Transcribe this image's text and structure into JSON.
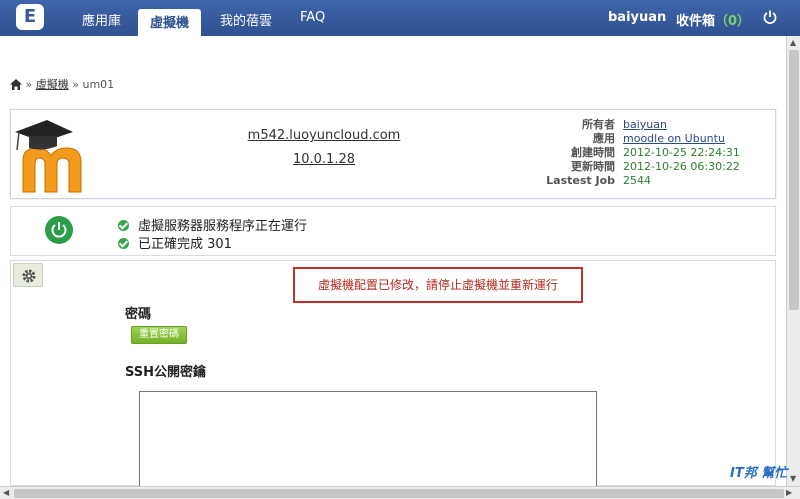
{
  "nav": {
    "logo_glyph": "E",
    "items": [
      {
        "label": "應用庫"
      },
      {
        "label": "虛擬機"
      },
      {
        "label": "我的蓓雲"
      },
      {
        "label": "FAQ"
      }
    ],
    "user": "baiyuan",
    "inbox_label": "收件箱",
    "inbox_count": "（0）"
  },
  "breadcrumb": {
    "sep": "»",
    "link": "虛擬機",
    "current": "um01"
  },
  "vm": {
    "host": "m542.luoyuncloud.com",
    "ip": "10.0.1.28",
    "labels": [
      "所有者",
      "應用",
      "創建時間",
      "更新時間",
      "Lastest Job"
    ],
    "owner": "baiyuan",
    "app": "moodle on Ubuntu",
    "created": "2012-10-25 22:24:31",
    "updated": "2012-10-26 06:30:22",
    "job": "2544"
  },
  "status": {
    "line1": "虛擬服務器服務程序正在運行",
    "line2": "已正確完成 301"
  },
  "config": {
    "alert": "虛擬機配置已修改，請停止虛擬機並重新運行",
    "password_title": "密碼",
    "reset_label": "重置密碼",
    "ssh_title": "SSH公開密鑰"
  },
  "watermark": "IT邦 幫忙",
  "colors": {
    "nav_bg": "#365b9c",
    "power_green": "#2a9d48",
    "alert_red": "#c0312b"
  }
}
